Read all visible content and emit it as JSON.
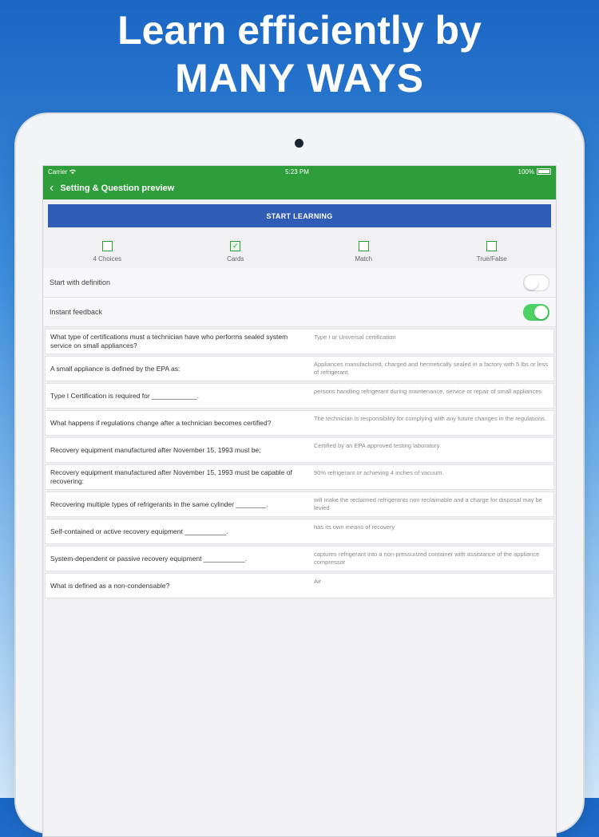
{
  "headline": {
    "line1": "Learn efficiently by",
    "line2": "MANY WAYS"
  },
  "status_bar": {
    "carrier": "Carrier",
    "time": "5:23 PM",
    "battery": "100%"
  },
  "nav": {
    "back_icon": "chevron-left-icon",
    "title": "Setting & Question preview"
  },
  "start_button": "START LEARNING",
  "modes": [
    {
      "label": "4 Choices",
      "checked": false
    },
    {
      "label": "Cards",
      "checked": true
    },
    {
      "label": "Match",
      "checked": false
    },
    {
      "label": "True/False",
      "checked": false
    }
  ],
  "settings": [
    {
      "label": "Start with definition",
      "on": false
    },
    {
      "label": "Instant feedback",
      "on": true
    }
  ],
  "questions": [
    {
      "q": "What type of certifications must a technician have who performs sealed system service on small appliances?",
      "a": "Type I or Universal certification"
    },
    {
      "q": "A small appliance is defined by the EPA as:",
      "a": "Appliances manufactured, charged and hermetically sealed in a factory with 5 lbs or less of refrigerant."
    },
    {
      "q": "Type I Certification is required for ____________.",
      "a": "persons handling refrigerant during maintenance, service or repair of small appliances"
    },
    {
      "q": "What happens if regulations change after a technician becomes certified?",
      "a": "The technician is responsibility for complying with any future changes in the regulations."
    },
    {
      "q": "Recovery equipment manufactured after November 15, 1993 must be;",
      "a": "Certified by an EPA approved testing laboratory."
    },
    {
      "q": "Recovery equipment manufactured after November 15, 1993 must be capable of recovering:",
      "a": "90% refrigerant or achieving 4 inches of vacuum."
    },
    {
      "q": "Recovering multiple types of refrigerants in the same cylinder ________.",
      "a": "will make the reclaimed refrigerants non reclaimable and a charge for disposal may be levied"
    },
    {
      "q": "Self-contained or active recovery equipment ___________.",
      "a": "has its own means of recovery"
    },
    {
      "q": "System-dependent or passive recovery equipment ___________.",
      "a": "captures refrigerant into a non-pressurized container with assistance of the appliance compressor"
    },
    {
      "q": "What is defined as a non-condensable?",
      "a": "Air"
    }
  ],
  "colors": {
    "nav_green": "#2e9e3a",
    "button_blue": "#2f5db6",
    "toggle_on": "#4cd264"
  }
}
